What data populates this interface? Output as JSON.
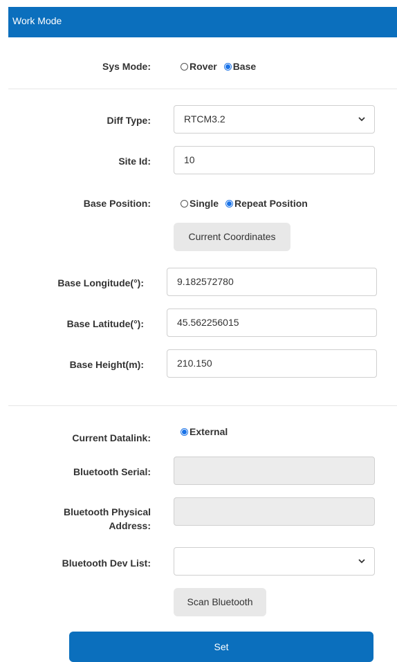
{
  "header": {
    "title": "Work Mode"
  },
  "sys_mode": {
    "label": "Sys Mode:",
    "options": [
      "Rover",
      "Base"
    ],
    "selected": "Base"
  },
  "diff_type": {
    "label": "Diff Type:",
    "value": "RTCM3.2"
  },
  "site_id": {
    "label": "Site Id:",
    "value": "10"
  },
  "base_position": {
    "label": "Base Position:",
    "options": [
      "Single",
      "Repeat Position"
    ],
    "selected": "Repeat Position"
  },
  "current_coordinates_button": "Current Coordinates",
  "base_longitude": {
    "label": "Base Longitude(°):",
    "value": "9.182572780"
  },
  "base_latitude": {
    "label": "Base Latitude(°):",
    "value": "45.562256015"
  },
  "base_height": {
    "label": "Base Height(m):",
    "value": "210.150"
  },
  "current_datalink": {
    "label": "Current Datalink:",
    "option": "External",
    "selected": true
  },
  "bluetooth_serial": {
    "label": "Bluetooth Serial:",
    "value": ""
  },
  "bluetooth_physical_address": {
    "label_line1": "Bluetooth Physical",
    "label_line2": "Address:",
    "value": ""
  },
  "bluetooth_dev_list": {
    "label": "Bluetooth Dev List:",
    "value": ""
  },
  "scan_bluetooth_button": "Scan Bluetooth",
  "set_button": "Set",
  "colors": {
    "accent": "#0b6fbd",
    "radio_checked": "#1a73e8",
    "disabled_field": "#ececec",
    "gray_button": "#e8e8e8"
  }
}
